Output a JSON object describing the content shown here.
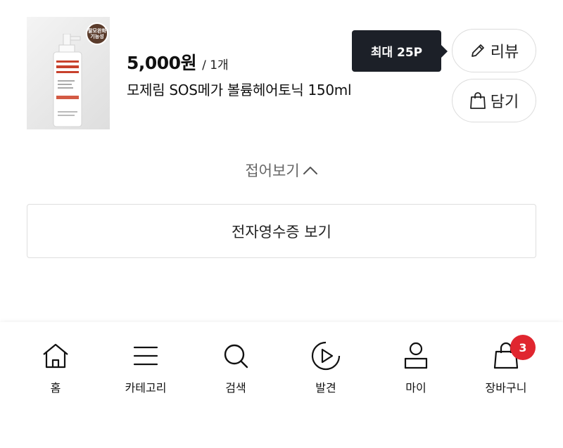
{
  "product": {
    "badge_text": "탈모완화 기능성",
    "price": "5,000원",
    "quantity": "/ 1개",
    "name": "모제림 SOS메가 볼륨헤어토닉 150ml"
  },
  "tooltip": {
    "text": "최대 25P"
  },
  "actions": {
    "review_label": "리뷰",
    "cart_label": "담기"
  },
  "collapse": {
    "label": "접어보기"
  },
  "receipt": {
    "label": "전자영수증 보기"
  },
  "bottom_nav": {
    "items": [
      {
        "label": "홈",
        "icon": "home-icon"
      },
      {
        "label": "카테고리",
        "icon": "menu-icon"
      },
      {
        "label": "검색",
        "icon": "search-icon"
      },
      {
        "label": "발견",
        "icon": "play-icon"
      },
      {
        "label": "마이",
        "icon": "user-icon"
      },
      {
        "label": "장바구니",
        "icon": "shopping-bag-icon"
      }
    ],
    "cart_badge": "3",
    "badge_color": "#e0262f"
  },
  "colors": {
    "tooltip_bg": "#1c2028",
    "border": "#dcdcdc"
  }
}
